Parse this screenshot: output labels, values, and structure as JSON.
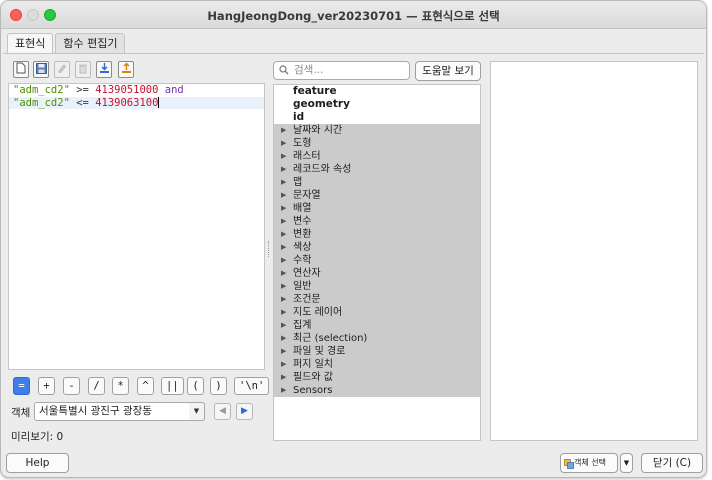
{
  "window": {
    "title": "HangJeongDong_ver20230701 — 표현식으로 선택"
  },
  "tabs": [
    {
      "label": "표현식"
    },
    {
      "label": "함수 편집기"
    }
  ],
  "toolbar": {
    "icons": [
      "new-file-icon",
      "save-icon",
      "edit-icon",
      "delete-icon",
      "import-icon",
      "export-icon"
    ]
  },
  "editor": {
    "lines": [
      {
        "field": "\"adm_cd2\"",
        "op": " >= ",
        "value": "4139051000",
        "keyword": " and"
      },
      {
        "field": "\"adm_cd2\"",
        "op": " <= ",
        "value": "4139063100",
        "keyword": ""
      }
    ]
  },
  "operators": [
    "=",
    "+",
    "-",
    "/",
    "*",
    "^",
    "||",
    "(",
    ")",
    "'\\n'"
  ],
  "feature": {
    "label": "객체",
    "selected": "서울특별시 광진구 광장동"
  },
  "preview": {
    "label": "미리보기:",
    "value": "0"
  },
  "search": {
    "placeholder": "검색..."
  },
  "help_view_label": "도움말 보기",
  "function_list": {
    "plain_items": [
      "feature",
      "geometry",
      "id"
    ],
    "groups": [
      "날짜와 시간",
      "도형",
      "래스터",
      "레코드와 속성",
      "맵",
      "문자열",
      "배열",
      "변수",
      "변환",
      "색상",
      "수학",
      "연산자",
      "일반",
      "조건문",
      "지도 레이어",
      "집계",
      "최근 (selection)",
      "파일 및 경로",
      "퍼지 일치",
      "필드와 값",
      "Sensors"
    ]
  },
  "footer": {
    "help_label": "Help",
    "select_features_label": "객체 선택",
    "close_label": "닫기 (C)"
  },
  "colors": {
    "accent": "#3f7ee8",
    "group_row": "#cbcbcb",
    "field": "#4f8f00",
    "number": "#c8102e",
    "keyword": "#7a2fb1"
  }
}
